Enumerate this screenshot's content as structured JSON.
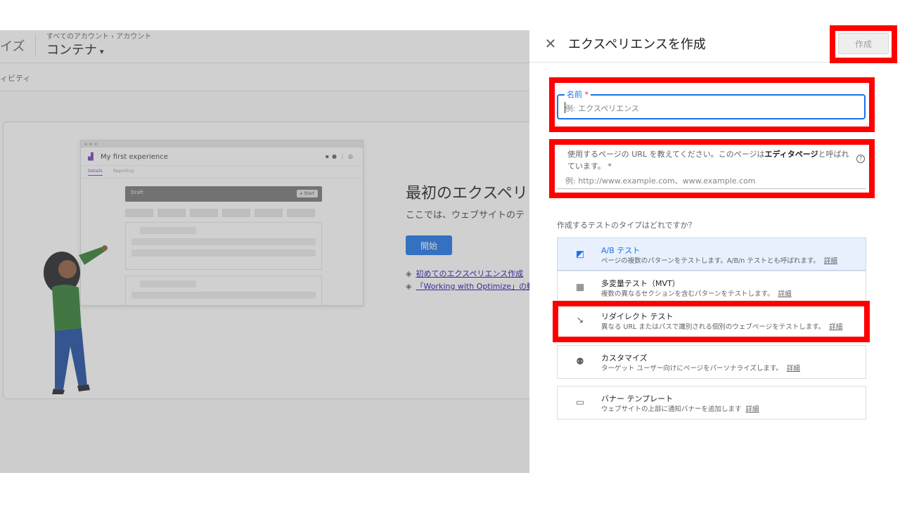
{
  "background_app": {
    "brand_fragment": "イズ",
    "breadcrumb": "すべてのアカウント › アカウント",
    "container_title": "コンテナ",
    "activity_tab": "ィビティ",
    "mock": {
      "title": "My first experience",
      "tab_details": "Details",
      "tab_reporting": "Reporting",
      "draft_label": "Draft",
      "start_label": "▸ Start"
    },
    "headline": "最初のエクスペリ",
    "subline": "ここでは、ウェブサイトのテ",
    "start_button": "開始",
    "links": [
      "初めてのエクスペリエンス作成",
      "「Working with Optimize」の動"
    ]
  },
  "panel": {
    "title": "エクスペリエンスを作成",
    "create_button": "作成",
    "name_field": {
      "label": "名前",
      "required_mark": "*",
      "placeholder": "例: エクスペリエンス"
    },
    "url_field": {
      "description_pre": "使用するページの URL を教えてください。このページは",
      "description_bold": "エディタページ",
      "description_post": "と呼ばれています。",
      "required_mark": " *",
      "placeholder": "例: http://www.example.com、www.example.com"
    },
    "types_question": "作成するテストのタイプはどれですか？",
    "types": [
      {
        "name": "A/B テスト",
        "desc": "ページの複数のパターンをテストします。A/B/n テストとも呼ばれます。",
        "more": "詳細",
        "icon": "ab-test-icon",
        "selected": true
      },
      {
        "name": "多変量テスト（MVT）",
        "desc": "複数の異なるセクションを含むパターンをテストします。",
        "more": "詳細",
        "icon": "mvt-grid-icon",
        "selected": false
      },
      {
        "name": "リダイレクト テスト",
        "desc": "異なる URL またはパスで識別される個別のウェブページをテストします。",
        "more": "詳細",
        "icon": "redirect-icon",
        "selected": false
      },
      {
        "name": "カスタマイズ",
        "desc": "ターゲット ユーザー向けにページをパーソナライズします。",
        "more": "詳細",
        "icon": "personalize-icon",
        "selected": false
      },
      {
        "name": "バナー テンプレート",
        "desc": "ウェブサイトの上部に通知バナーを追加します",
        "more": "詳細",
        "icon": "banner-icon",
        "selected": false
      }
    ]
  },
  "colors": {
    "accent": "#1a73e8",
    "highlight": "#ff0000",
    "selected_bg": "#e8f0fe"
  }
}
